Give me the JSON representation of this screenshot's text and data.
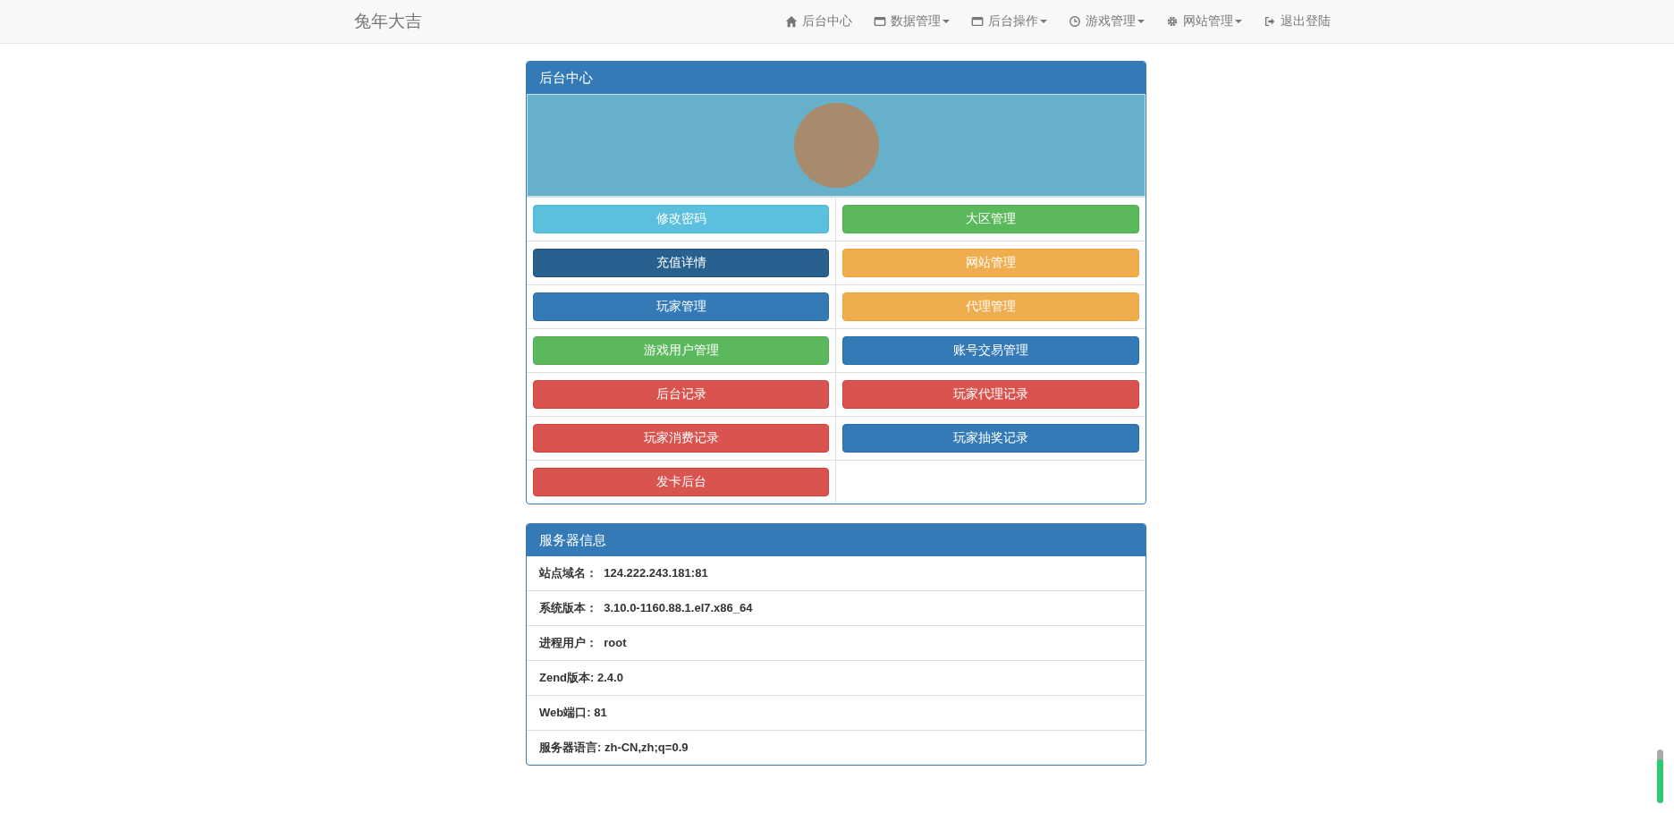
{
  "navbar": {
    "brand": "兔年大吉",
    "items": [
      {
        "label": "后台中心",
        "dropdown": false
      },
      {
        "label": "数据管理",
        "dropdown": true
      },
      {
        "label": "后台操作",
        "dropdown": true
      },
      {
        "label": "游戏管理",
        "dropdown": true
      },
      {
        "label": "网站管理",
        "dropdown": true
      },
      {
        "label": "退出登陆",
        "dropdown": false
      }
    ]
  },
  "admin_panel": {
    "title": "后台中心",
    "buttons": [
      {
        "label": "修改密码",
        "kind": "info",
        "active": false
      },
      {
        "label": "大区管理",
        "kind": "success",
        "active": false
      },
      {
        "label": "充值详情",
        "kind": "primary",
        "active": true
      },
      {
        "label": "网站管理",
        "kind": "warning",
        "active": false
      },
      {
        "label": "玩家管理",
        "kind": "primary",
        "active": false
      },
      {
        "label": "代理管理",
        "kind": "warning",
        "active": false
      },
      {
        "label": "游戏用户管理",
        "kind": "success",
        "active": false
      },
      {
        "label": "账号交易管理",
        "kind": "primary",
        "active": false
      },
      {
        "label": "后台记录",
        "kind": "danger",
        "active": false
      },
      {
        "label": "玩家代理记录",
        "kind": "danger",
        "active": false
      },
      {
        "label": "玩家消费记录",
        "kind": "danger",
        "active": false
      },
      {
        "label": "玩家抽奖记录",
        "kind": "primary",
        "active": false
      },
      {
        "label": "发卡后台",
        "kind": "danger",
        "active": false
      }
    ]
  },
  "server_panel": {
    "title": "服务器信息",
    "rows": [
      "站点域名：  124.222.243.181:81",
      "系统版本：  3.10.0-1160.88.1.el7.x86_64",
      "进程用户：  root",
      "Zend版本: 2.4.0",
      "Web端口: 81",
      "服务器语言: zh-CN,zh;q=0.9"
    ]
  },
  "side_meter": {
    "level": 0.82
  }
}
